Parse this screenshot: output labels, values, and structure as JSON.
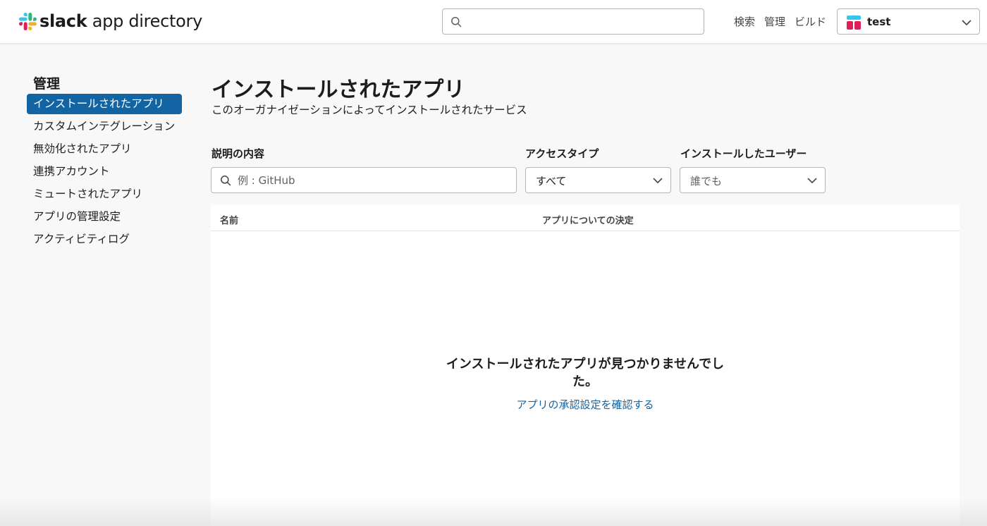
{
  "header": {
    "logo_bold": "slack",
    "logo_rest": " app directory",
    "search_placeholder": "",
    "nav": [
      "検索",
      "管理",
      "ビルド"
    ],
    "workspace": "test"
  },
  "sidebar": {
    "title": "管理",
    "items": [
      {
        "label": "インストールされたアプリ",
        "active": true
      },
      {
        "label": "カスタムインテグレーション",
        "active": false
      },
      {
        "label": "無効化されたアプリ",
        "active": false
      },
      {
        "label": "連携アカウント",
        "active": false
      },
      {
        "label": "ミュートされたアプリ",
        "active": false
      },
      {
        "label": "アプリの管理設定",
        "active": false
      },
      {
        "label": "アクティビティログ",
        "active": false
      }
    ]
  },
  "main": {
    "title": "インストールされたアプリ",
    "subtitle": "このオーガナイゼーションによってインストールされたサービス",
    "filters": {
      "description_label": "説明の内容",
      "description_placeholder": "例 : GitHub",
      "access_label": "アクセスタイプ",
      "access_value": "すべて",
      "installer_label": "インストールしたユーザー",
      "installer_value": "誰でも"
    },
    "table": {
      "col_name": "名前",
      "col_decision": "アプリについての決定",
      "empty_title": "インストールされたアプリが見つかりませんでした。",
      "empty_link": "アプリの承認設定を確認する"
    }
  },
  "colors": {
    "accent": "#1264a3",
    "text": "#1d1c1d"
  }
}
